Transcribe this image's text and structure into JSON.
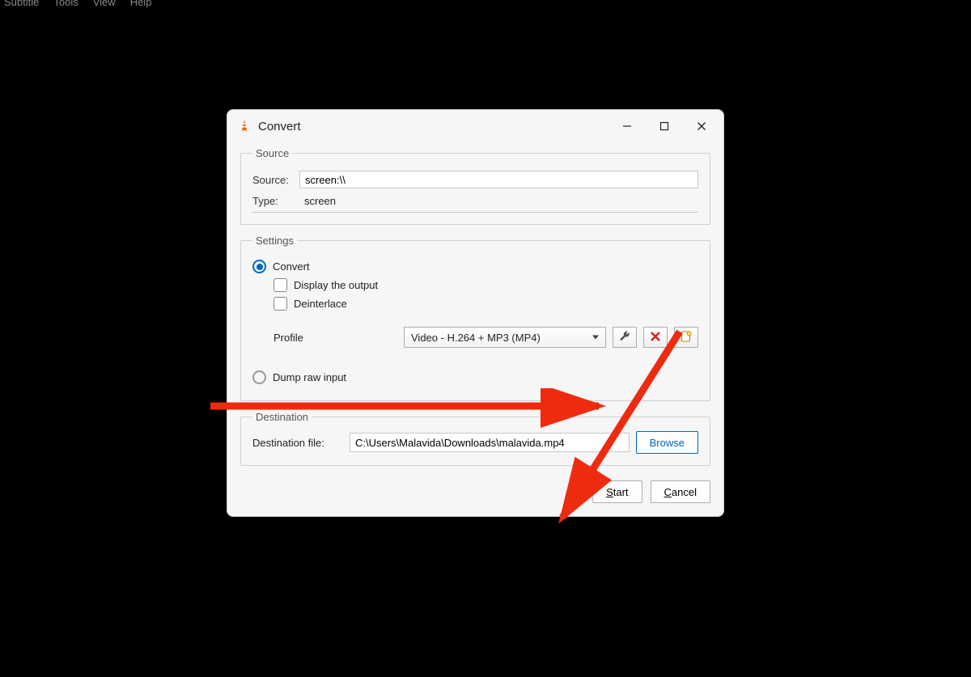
{
  "menubar": [
    "Subtitle",
    "Tools",
    "View",
    "Help"
  ],
  "dialog": {
    "title": "Convert",
    "source": {
      "legend": "Source",
      "source_label": "Source:",
      "source_value": "screen:\\\\",
      "type_label": "Type:",
      "type_value": "screen"
    },
    "settings": {
      "legend": "Settings",
      "convert_label": "Convert",
      "display_output_label": "Display the output",
      "deinterlace_label": "Deinterlace",
      "profile_label": "Profile",
      "profile_value": "Video - H.264 + MP3 (MP4)",
      "dump_label": "Dump raw input"
    },
    "destination": {
      "legend": "Destination",
      "file_label": "Destination file:",
      "file_value": "C:\\Users\\Malavida\\Downloads\\malavida.mp4",
      "browse_label": "Browse"
    },
    "footer": {
      "start": "Start",
      "cancel": "Cancel"
    }
  }
}
